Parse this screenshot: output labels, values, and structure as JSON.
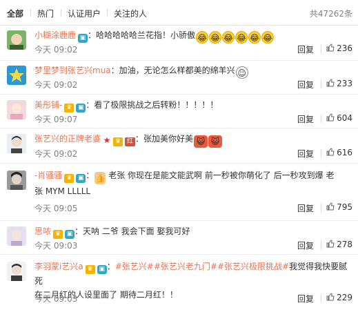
{
  "tabs": {
    "items": [
      "全部",
      "热门",
      "认证用户",
      "关注的人"
    ],
    "count": "共47262条"
  },
  "colors": {
    "username": "#eb7350",
    "muted": "#808080",
    "topic": "#eb7350"
  },
  "reply_label": "回复",
  "comments": [
    {
      "user": "小糊涂鹿鹿",
      "badges": [
        "camera-icon"
      ],
      "text_line1": "：哈哈哈哈哈兰花指！小骄傲",
      "emojis": [
        "laugh-emoji",
        "laugh-emoji",
        "laugh-emoji",
        "laugh-emoji",
        "laugh-emoji",
        "laugh-emoji"
      ],
      "time": "今天 09:02",
      "likes": "236"
    },
    {
      "user": "梦里梦到张艺兴mua",
      "badges": [],
      "text_line1": "：加油，无论怎么样都美的绵羊兴",
      "emojis": [
        "doraemon-emoji"
      ],
      "time": "今天 09:02",
      "likes": "233"
    },
    {
      "user": "美彤铺-",
      "badges": [
        "vip-icon",
        "camera-icon"
      ],
      "text_line1": "：看了极限挑战之后转粉！！！！！",
      "time": "今天 09:07",
      "likes": "604"
    },
    {
      "user": "张艺兴的正牌老婆",
      "badges": [
        "star-icon",
        "vip-icon",
        "hong-badge"
      ],
      "badge_hong": "红",
      "text_line1": "：张加美你好美",
      "emojis": [
        "cat-emoji",
        "cat-emoji"
      ],
      "time": "今天 09:02",
      "likes": "616"
    },
    {
      "user": "-肖骚骚",
      "badges": [
        "vip-icon",
        "camera-icon"
      ],
      "text_line1": "：",
      "text_after_emoji": "老张 你现在是能文能武啊  前一秒被你萌化了 后一秒攻到爆 老",
      "text_line2": "张  MYM LLLLL",
      "emojis": [
        "thumbs-up-emoji"
      ],
      "time": "今天 09:05",
      "likes": "795"
    },
    {
      "user": "思哝",
      "badges": [
        "vip-icon",
        "camera-icon"
      ],
      "text_line1": "：天呐  二爷  我会下面  娶我可好",
      "time": "今天 09:03",
      "likes": "278"
    },
    {
      "user": "李羽蒙i艺兴a",
      "badges": [
        "vip-icon",
        "camera-icon"
      ],
      "text_line1_prefix": "：",
      "topics": [
        "#张艺兴#",
        "#张艺兴老九门#",
        "#张艺兴极限挑战#"
      ],
      "text_line1_suffix": "我觉得我快要腻死",
      "text_line2": "在二月红的人设里面了  期待二月红！！",
      "time": "今天 09:03",
      "likes": "229"
    }
  ]
}
